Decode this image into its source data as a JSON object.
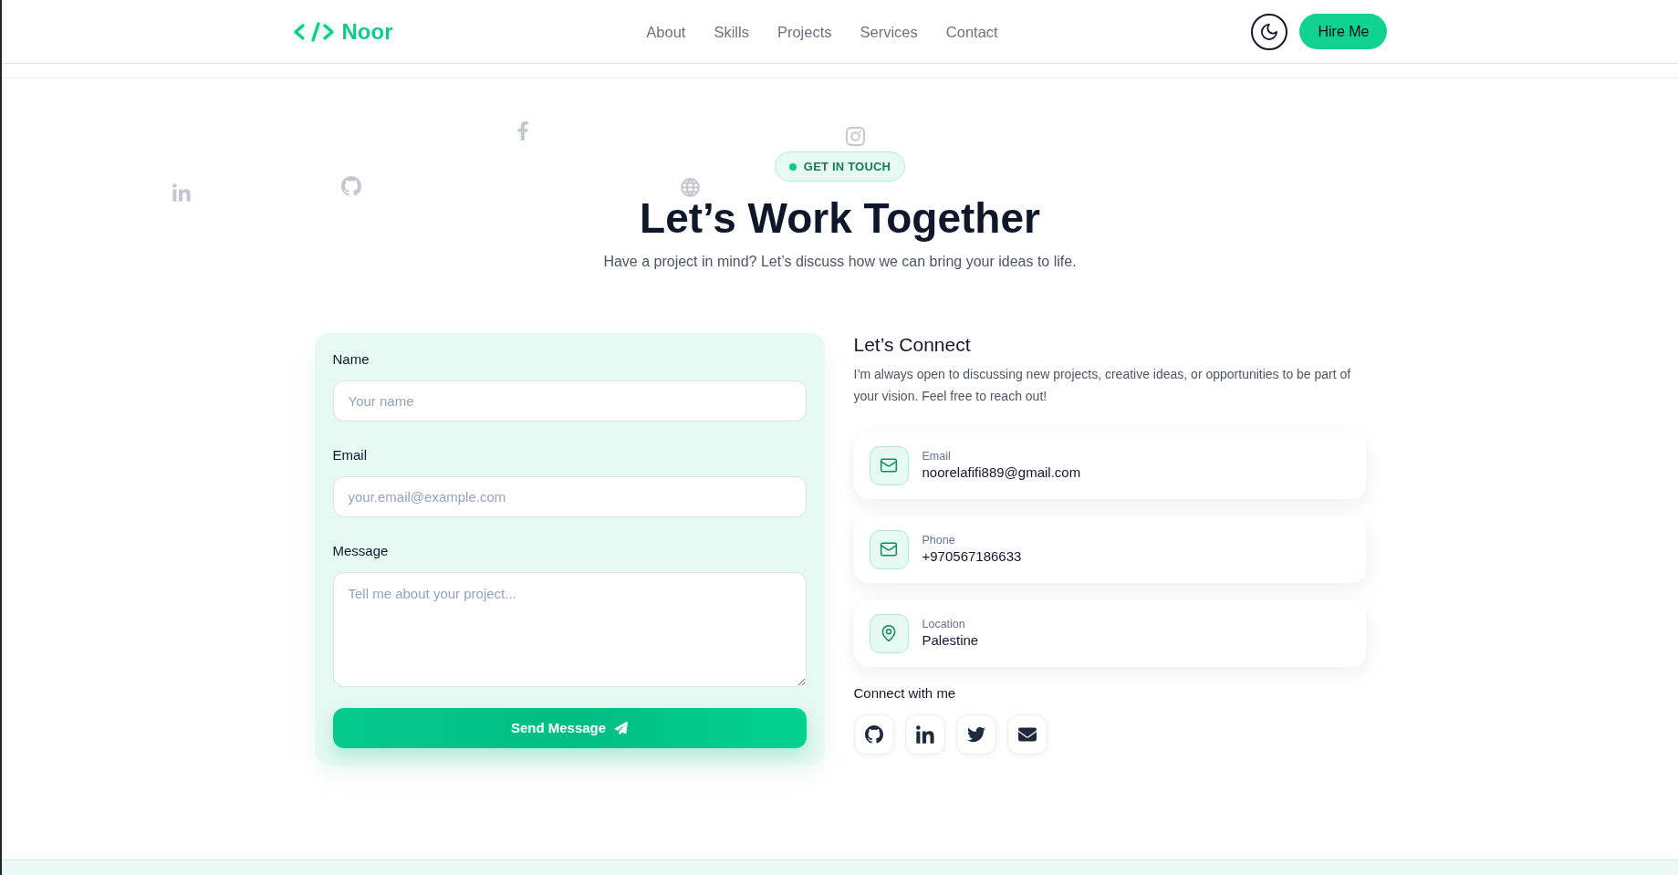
{
  "navbar": {
    "brand": "Noor",
    "links": [
      {
        "label": "About",
        "selected": false
      },
      {
        "label": "Skills",
        "selected": false
      },
      {
        "label": "Projects",
        "selected": false
      },
      {
        "label": "Services",
        "selected": false
      },
      {
        "label": "Contact",
        "selected": false
      }
    ],
    "cta": "Hire Me"
  },
  "hero": {
    "badge": "GET IN TOUCH",
    "title": "Let’s Work Together",
    "subtitle": "Have a project in mind? Let’s discuss how we can bring your ideas to life."
  },
  "contact_form": {
    "fields": [
      {
        "kind": "input",
        "label": "Name",
        "placeholder": "Your name"
      },
      {
        "kind": "input",
        "label": "Email",
        "placeholder": "your.email@example.com"
      },
      {
        "kind": "textarea",
        "label": "Message",
        "placeholder": "Tell me about your project..."
      }
    ],
    "submit": "Send Message"
  },
  "connect": {
    "title": "Let’s Connect",
    "text": "I’m always open to discussing new projects, creative ideas, or opportunities to be part of your vision. Feel free to reach out!",
    "items": [
      {
        "label": "Email",
        "value": "noorelafifi889@gmail.com"
      },
      {
        "label": "Phone",
        "value": "+970567186633"
      },
      {
        "label": "Location",
        "value": "Palestine"
      }
    ],
    "social_title": "Connect with me"
  }
}
